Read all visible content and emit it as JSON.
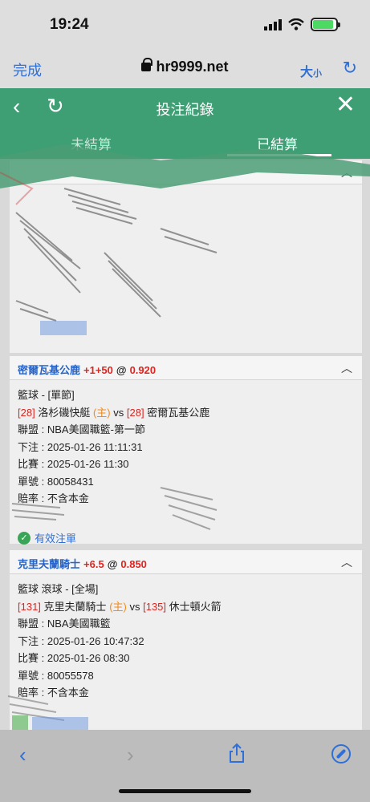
{
  "status_bar": {
    "time": "19:24"
  },
  "browser": {
    "done_label": "完成",
    "url": "hr9999.net",
    "text_size_label": "大",
    "text_size_small": "小"
  },
  "header": {
    "title": "投注紀錄"
  },
  "tabs": {
    "unsettled": "未結算",
    "settled": "已結算"
  },
  "bets": [
    {
      "team": "密爾瓦基公鹿",
      "handicap": "+1+50",
      "at": "@",
      "odds": "0.920",
      "sport_type": "籃球 - [單節]",
      "home_num": "[28]",
      "home_team": "洛杉磯快艇",
      "home_tag": "(主)",
      "vs": "vs",
      "away_num": "[28]",
      "away_team": "密爾瓦基公鹿",
      "league": "聯盟 : NBA美國職籃-第一節",
      "bet_time": "下注 : 2025-01-26 11:11:31",
      "match_time": "比賽 : 2025-01-26 11:30",
      "ticket": "單號 : 80058431",
      "odds_type": "賠率 : 不含本金",
      "status": "有效注單"
    },
    {
      "team": "克里夫蘭騎士",
      "handicap": "+6.5",
      "at": "@",
      "odds": "0.850",
      "sport_type": "籃球 滾球 - [全場]",
      "home_num": "[131]",
      "home_team": "克里夫蘭騎士",
      "home_tag": "(主)",
      "vs": "vs",
      "away_num": "[135]",
      "away_team": "休士頓火箭",
      "league": "聯盟 : NBA美國職籃",
      "bet_time": "下注 : 2025-01-26 10:47:32",
      "match_time": "比賽 : 2025-01-26 08:30",
      "ticket": "單號 : 80055578",
      "odds_type": "賠率 : 不含本金"
    }
  ],
  "colors": {
    "accent_green": "#3e9e74",
    "link_blue": "#2f6fd6",
    "red": "#e0241f",
    "orange": "#f08a1c"
  }
}
